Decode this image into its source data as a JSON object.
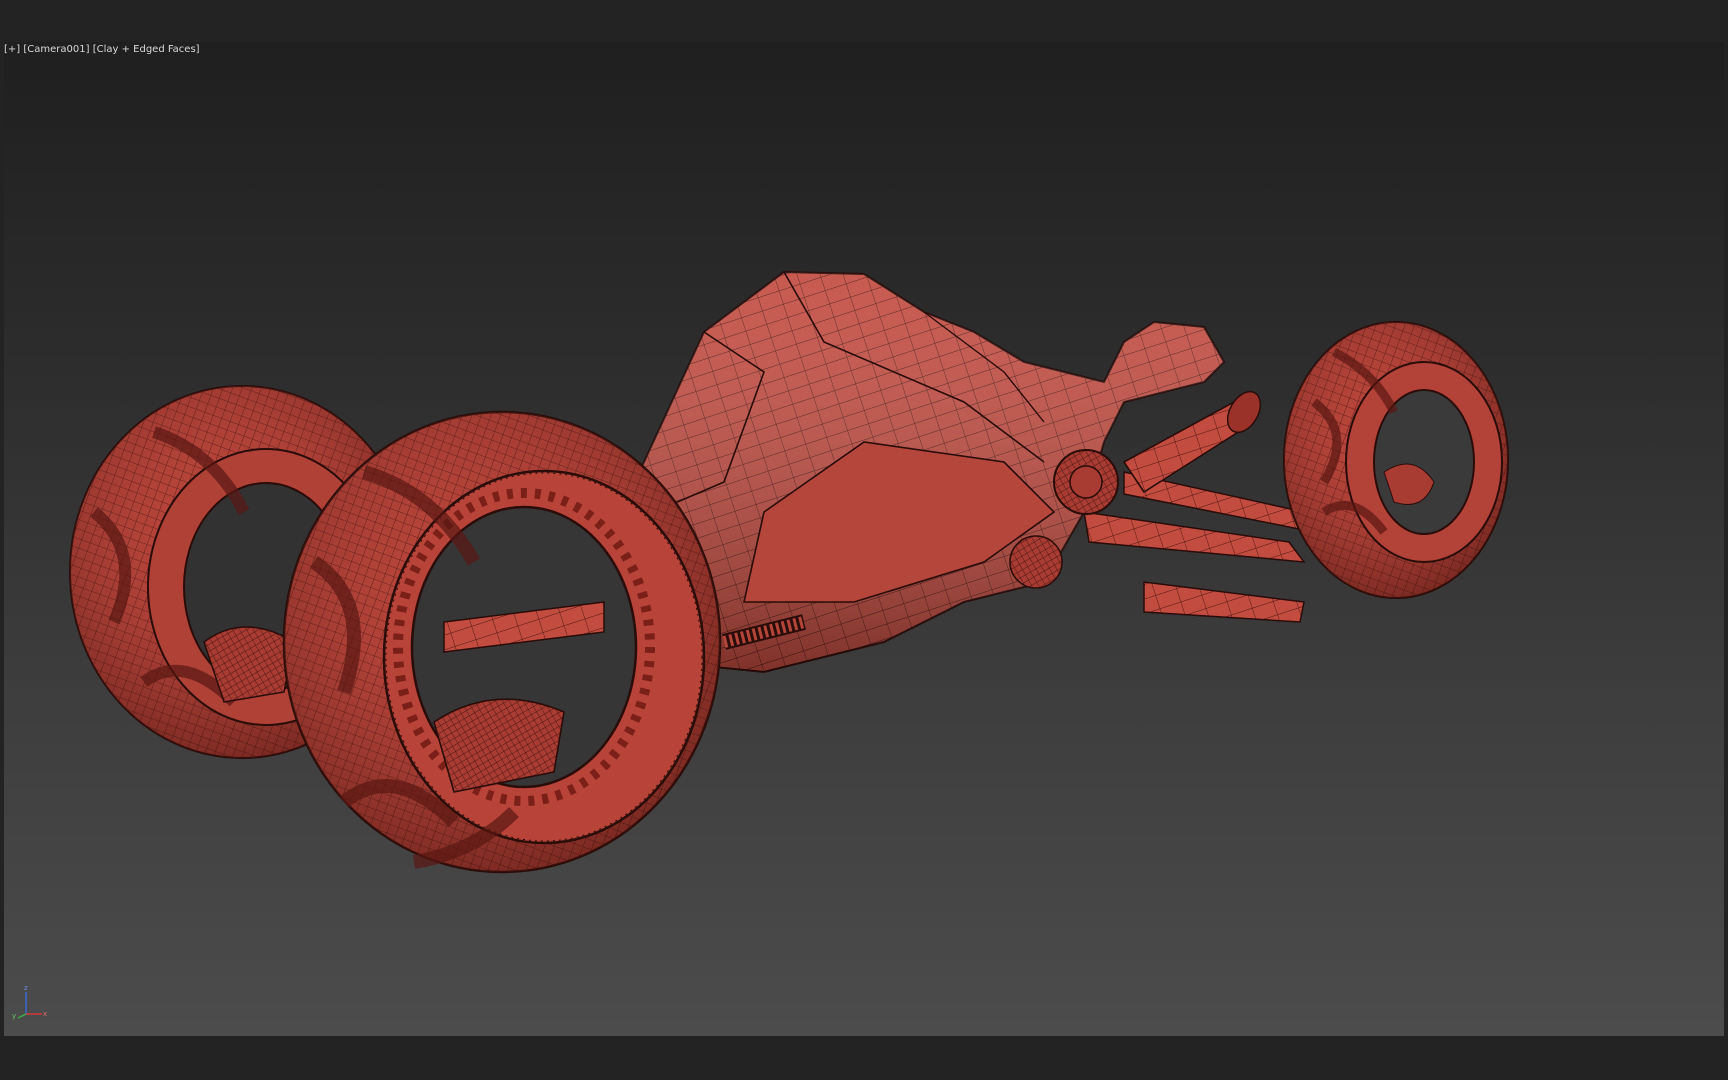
{
  "viewport": {
    "menu_label": "[+]",
    "camera_label": "[Camera001]",
    "shading_label": "[Clay + Edged Faces]"
  },
  "axis_gizmo": {
    "z_label": "z",
    "x_label": "x",
    "y_label": "y",
    "x_color": "#d23b3b",
    "y_color": "#3bb04b",
    "z_color": "#3b6bd2"
  },
  "colors": {
    "viewport_top": "#1f1f1f",
    "viewport_bottom": "#4c4c4c",
    "clay": "#c0473d",
    "clay_dark": "#6e1e18",
    "edge": "#2a0c09"
  },
  "scene": {
    "object": "three-wheeled-trike-model",
    "icon": "trike-model-icon"
  }
}
